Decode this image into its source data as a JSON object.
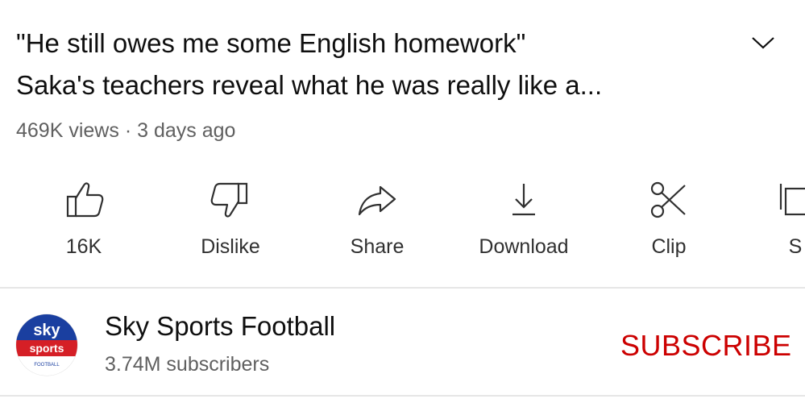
{
  "video": {
    "title_line1": "\"He still owes me some English homework\"",
    "title_line2": "Saka's teachers reveal what he was really like a...",
    "views": "469K views",
    "separator": "·",
    "age": "3 days ago"
  },
  "actions": [
    {
      "label": "16K",
      "icon": "thumbs-up-icon"
    },
    {
      "label": "Dislike",
      "icon": "thumbs-down-icon"
    },
    {
      "label": "Share",
      "icon": "share-icon"
    },
    {
      "label": "Download",
      "icon": "download-icon"
    },
    {
      "label": "Clip",
      "icon": "scissors-icon"
    },
    {
      "label": "S",
      "icon": "save-icon"
    }
  ],
  "channel": {
    "name": "Sky Sports Football",
    "subscribers": "3.74M subscribers",
    "subscribe_label": "SUBSCRIBE",
    "logo_text_top": "sky",
    "logo_text_mid": "sports",
    "logo_text_bottom": "FOOTBALL"
  },
  "colors": {
    "subscribe": "#cc0000",
    "logo_blue": "#1a3fa0",
    "logo_red": "#d51f26"
  }
}
